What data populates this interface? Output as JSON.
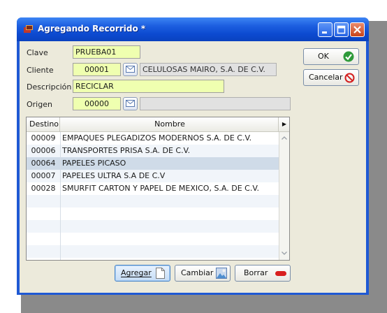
{
  "window": {
    "title": "Agregando Recorrido *"
  },
  "form": {
    "clave": {
      "label": "Clave",
      "value": "PRUEBA01"
    },
    "cliente": {
      "label": "Cliente",
      "value": "00001",
      "name": "CELULOSAS MAIRO, S.A. DE C.V."
    },
    "descripcion": {
      "label": "Descripción",
      "value": "RECICLAR"
    },
    "origen": {
      "label": "Origen",
      "value": "00000",
      "name": ""
    }
  },
  "actions": {
    "ok": "OK",
    "cancel": "Cancelar"
  },
  "grid": {
    "columns": [
      "Destino",
      "Nombre"
    ],
    "rows": [
      {
        "destino": "00009",
        "nombre": "EMPAQUES PLEGADIZOS MODERNOS S.A. DE C.V."
      },
      {
        "destino": "00006",
        "nombre": "TRANSPORTES PRISA S.A. DE C.V."
      },
      {
        "destino": "00064",
        "nombre": "PAPELES PICASO"
      },
      {
        "destino": "00007",
        "nombre": "PAPELES ULTRA S.A DE C.V"
      },
      {
        "destino": "00028",
        "nombre": "SMURFIT CARTON Y PAPEL DE MEXICO, S.A. DE C.V."
      }
    ],
    "selected_index": 2
  },
  "buttons": {
    "add": "Agregar",
    "change": "Cambiar",
    "delete": "Borrar"
  }
}
